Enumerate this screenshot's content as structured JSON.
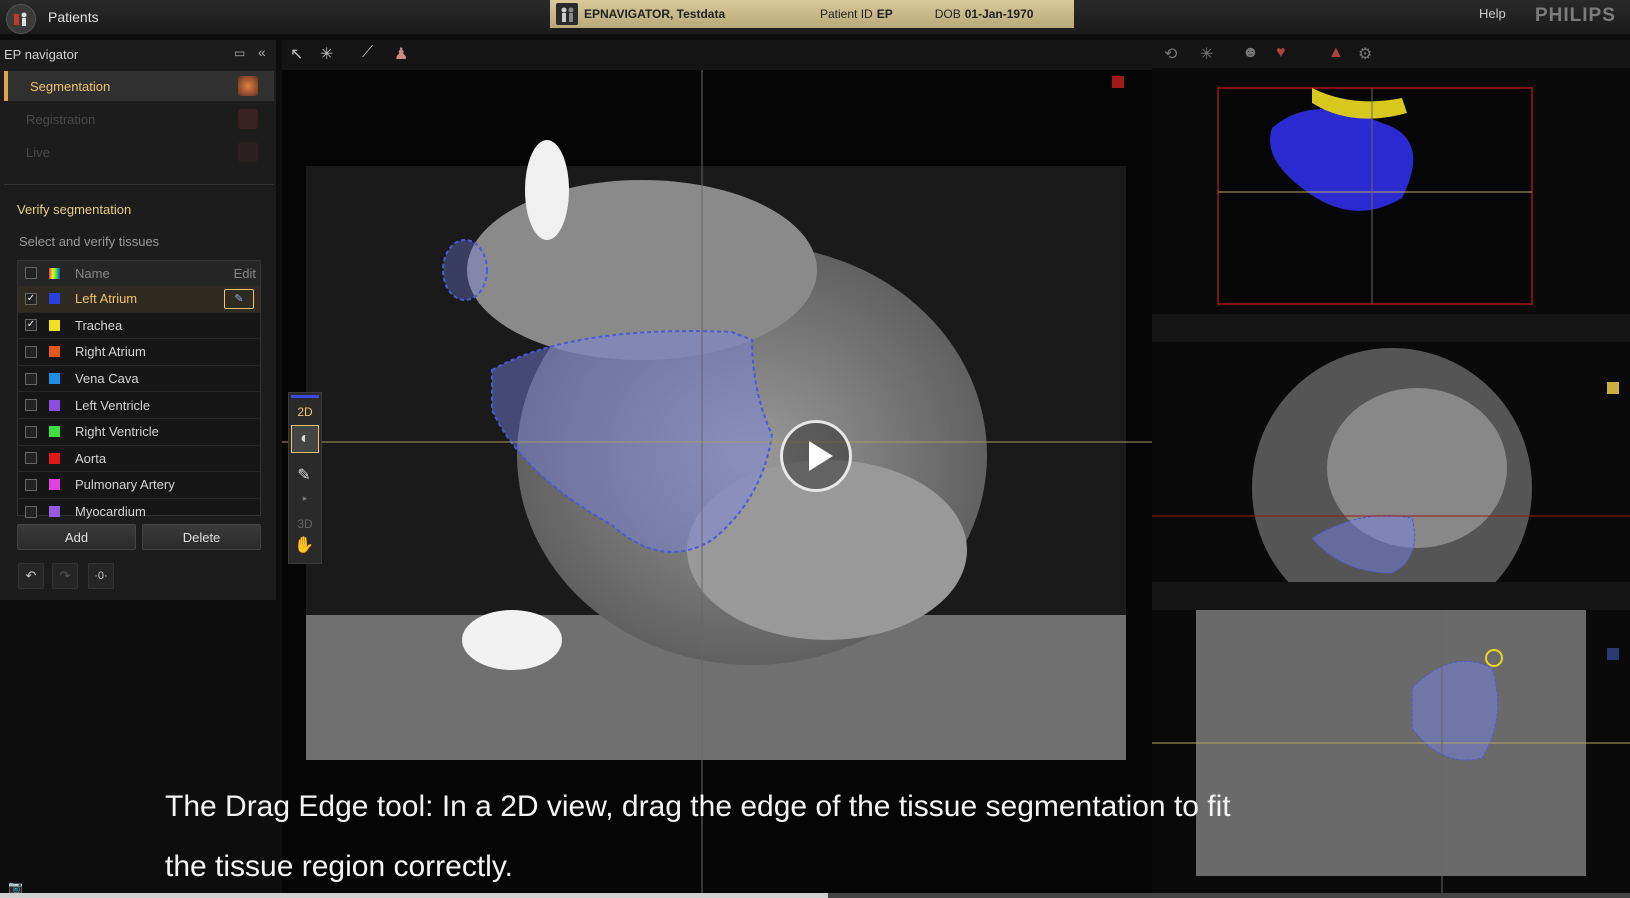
{
  "header": {
    "patients_label": "Patients",
    "patient_name": "EPNAVIGATOR, Testdata",
    "patient_id_label": "Patient ID",
    "patient_id_value": "EP",
    "dob_label": "DOB",
    "dob_value": "01-Jan-1970",
    "help_label": "Help",
    "brand": "PHILIPS"
  },
  "navigator": {
    "title": "EP navigator",
    "items": [
      {
        "label": "Segmentation"
      },
      {
        "label": "Registration"
      },
      {
        "label": "Live"
      }
    ]
  },
  "verify": {
    "title": "Verify segmentation",
    "subtitle": "Select and verify tissues",
    "name_header": "Name",
    "edit_header": "Edit",
    "tissues": [
      {
        "name": "Left Atrium",
        "color": "#2a3fe0",
        "checked": true
      },
      {
        "name": "Trachea",
        "color": "#f2e020",
        "checked": true
      },
      {
        "name": "Right Atrium",
        "color": "#e8561c",
        "checked": false
      },
      {
        "name": "Vena Cava",
        "color": "#1c8ee8",
        "checked": false
      },
      {
        "name": "Left Ventricle",
        "color": "#8a4ee0",
        "checked": false
      },
      {
        "name": "Right Ventricle",
        "color": "#3ee040",
        "checked": false
      },
      {
        "name": "Aorta",
        "color": "#e01818",
        "checked": false
      },
      {
        "name": "Pulmonary Artery",
        "color": "#e040e0",
        "checked": false
      },
      {
        "name": "Myocardium",
        "color": "#9a5ae0",
        "checked": false
      }
    ],
    "add_label": "Add",
    "delete_label": "Delete",
    "toggle_label": "·0·"
  },
  "tools": {
    "mode_2d": "2D",
    "mode_3d": "3D"
  },
  "caption": {
    "line1": "The Drag Edge tool: In a 2D view, drag the edge of the tissue segmentation to fit",
    "line2": "the tissue region correctly."
  },
  "video": {
    "progress": 0.508
  },
  "colors": {
    "accent": "#f0c46a",
    "banner": "#cfbf8f",
    "segmentation_blue": "#4a5ad8"
  }
}
